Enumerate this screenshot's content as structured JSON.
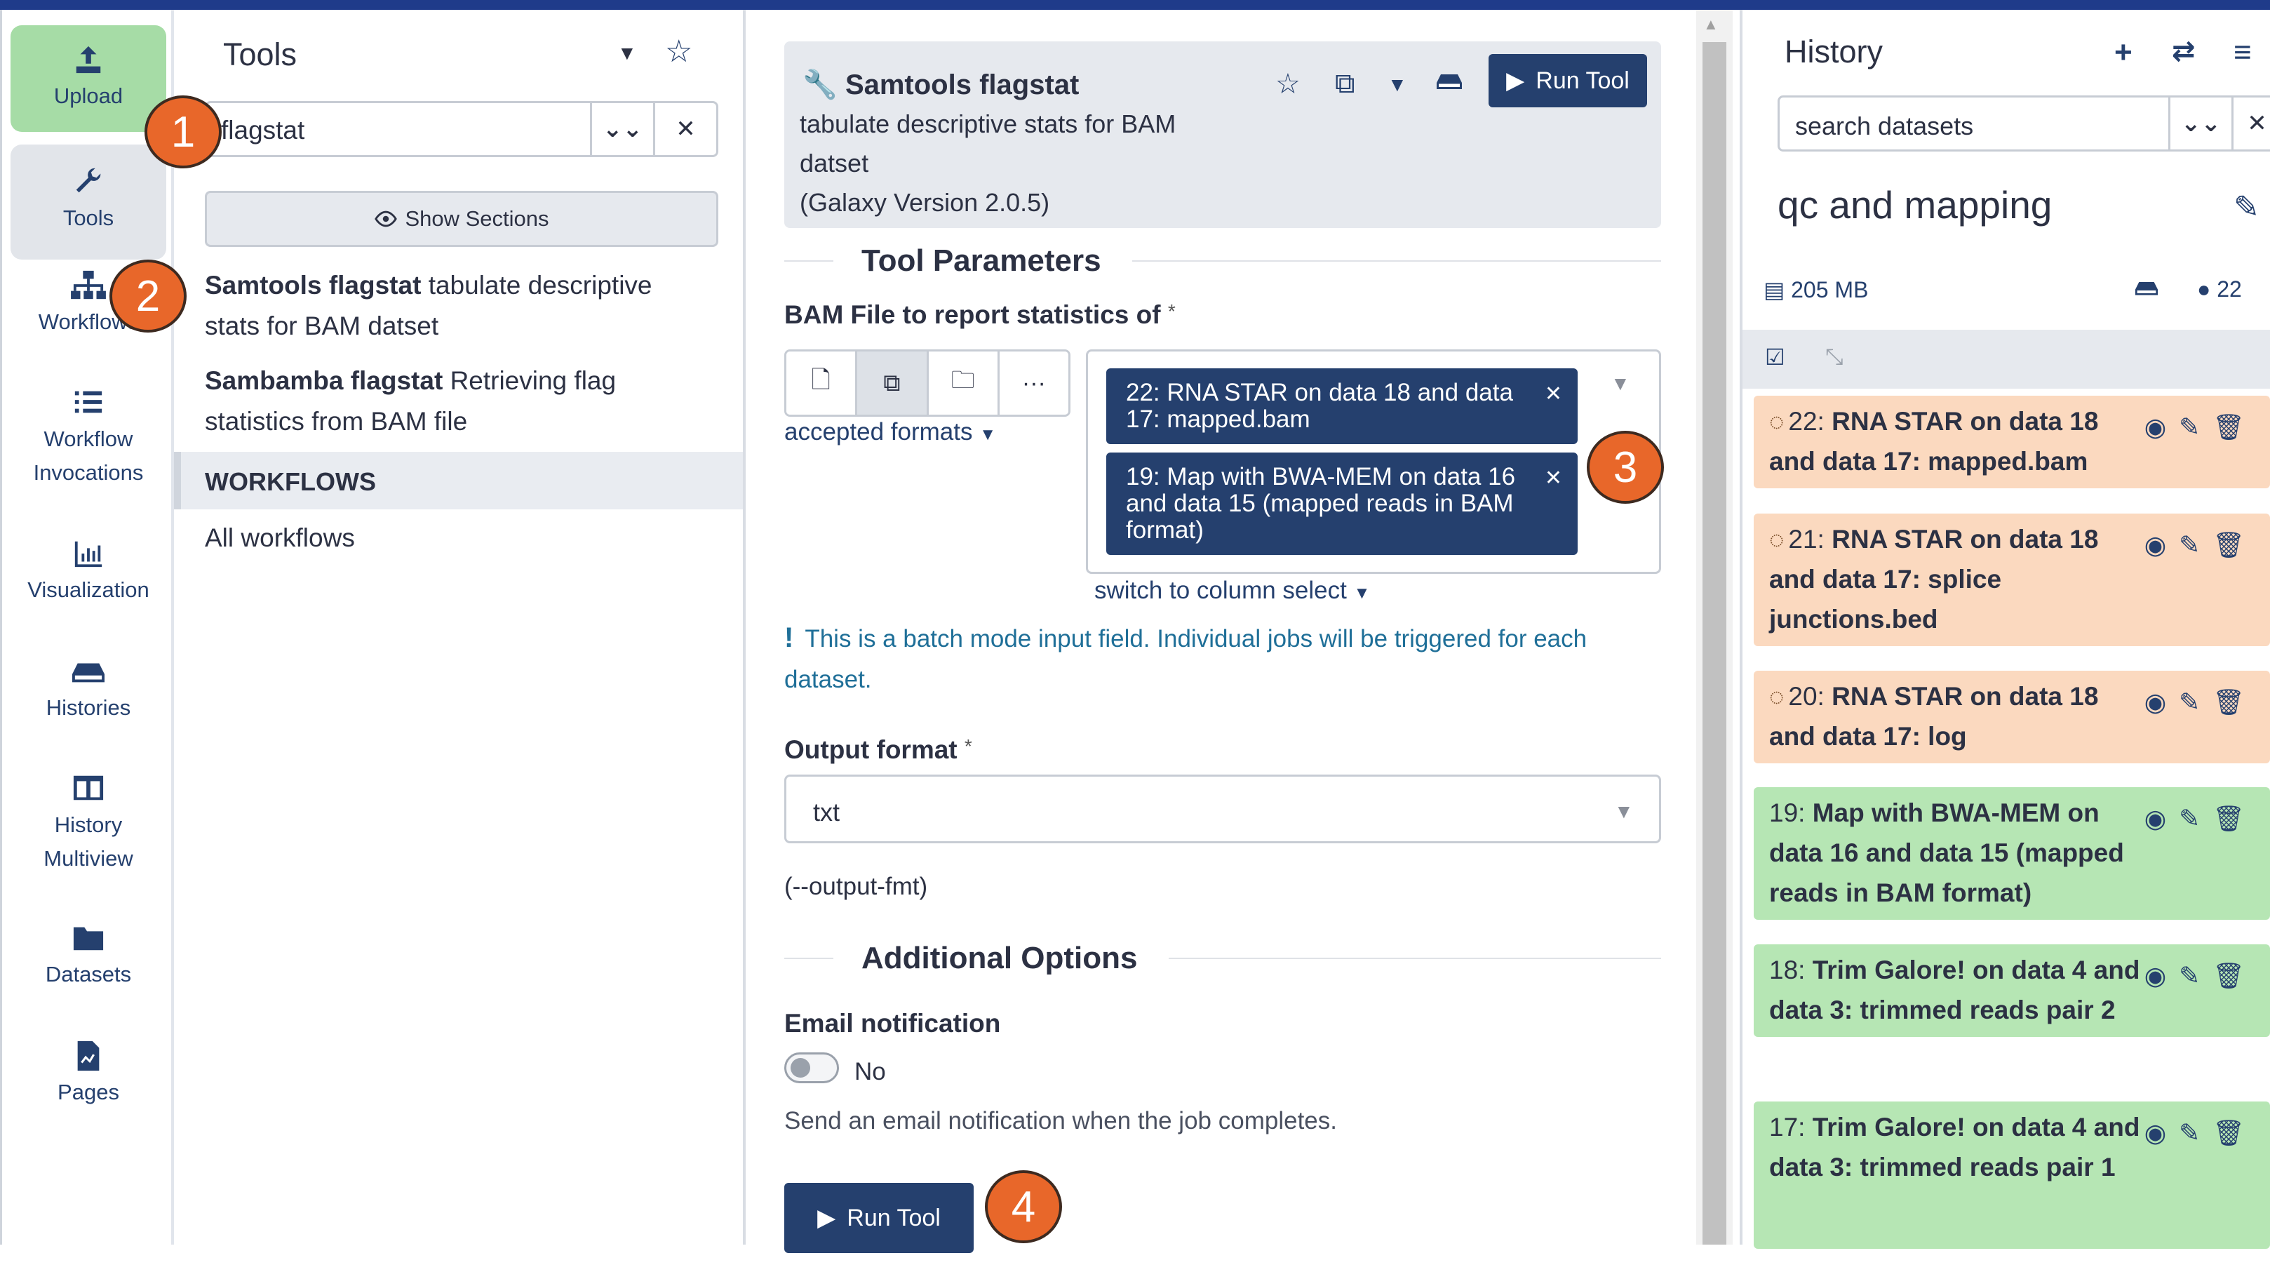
{
  "activity_bar": {
    "items": [
      {
        "label": "Upload",
        "icon": "upload-icon"
      },
      {
        "label": "Tools",
        "icon": "wrench-icon"
      },
      {
        "label": "Workflows",
        "icon": "sitemap-icon"
      },
      {
        "label": "Workflow Invocations",
        "icon": "list-icon"
      },
      {
        "label": "Visualization",
        "icon": "chart-icon"
      },
      {
        "label": "Histories",
        "icon": "hdd-icon"
      },
      {
        "label": "History Multiview",
        "icon": "columns-icon"
      },
      {
        "label": "Datasets",
        "icon": "folder-icon"
      },
      {
        "label": "Pages",
        "icon": "file-icon"
      }
    ]
  },
  "tool_panel": {
    "title": "Tools",
    "search_value": "flagstat",
    "show_sections_label": "Show Sections",
    "results": [
      {
        "name": "Samtools flagstat",
        "desc": "tabulate descriptive stats for BAM datset"
      },
      {
        "name": "Sambamba flagstat",
        "desc": "Retrieving flag statistics from BAM file"
      }
    ],
    "workflows_header": "WORKFLOWS",
    "all_workflows": "All workflows"
  },
  "tool_form": {
    "title": "Samtools flagstat",
    "description": "tabulate descriptive stats for BAM datset",
    "version": "(Galaxy Version 2.0.5)",
    "run_label": "Run Tool",
    "params_header": "Tool Parameters",
    "bam_label": "BAM File to report statistics of",
    "required_mark": "*",
    "accepted_formats": "accepted formats",
    "selected": [
      "22: RNA STAR on data 18 and data 17: mapped.bam",
      "19: Map with BWA-MEM on data 16 and data 15 (mapped reads in BAM format)"
    ],
    "switch_label": "switch to column select",
    "batch_note": "This is a batch mode input field. Individual jobs will be triggered for each dataset.",
    "output_label": "Output format",
    "output_value": "txt",
    "output_hint": "(--output-fmt)",
    "additional_header": "Additional Options",
    "email_label": "Email notification",
    "email_toggle": "No",
    "email_hint": "Send an email notification when the job completes."
  },
  "callouts": [
    "1",
    "2",
    "3",
    "4"
  ],
  "history": {
    "title": "History",
    "search_placeholder": "search datasets",
    "name": "qc and mapping",
    "size": "205 MB",
    "count": "22",
    "datasets": [
      {
        "hid": "22:",
        "name": "RNA STAR on data 18 and data 17: mapped.bam",
        "state": "queued"
      },
      {
        "hid": "21:",
        "name": "RNA STAR on data 18 and data 17: splice junctions.bed",
        "state": "queued"
      },
      {
        "hid": "20:",
        "name": "RNA STAR on data 18 and data 17: log",
        "state": "queued"
      },
      {
        "hid": "19:",
        "name": "Map with BWA-MEM on data 16 and data 15 (mapped reads in BAM format)",
        "state": "ok"
      },
      {
        "hid": "18:",
        "name": "Trim Galore! on data 4 and data 3: trimmed reads pair 2",
        "state": "ok"
      },
      {
        "hid": "17:",
        "name": "Trim Galore! on data 4 and data 3: trimmed reads pair 1",
        "state": "ok"
      }
    ]
  },
  "colors": {
    "accent": "#25406e",
    "upload_bg": "#a6dca6",
    "queued_bg": "#fbd9bf",
    "ok_bg": "#b6e6b4",
    "callout": "#e8672a"
  }
}
